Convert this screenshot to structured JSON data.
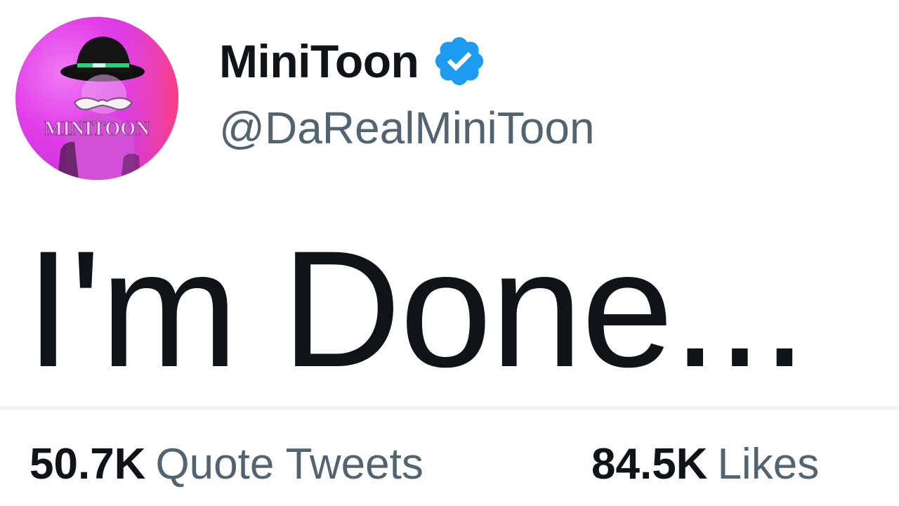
{
  "author": {
    "display_name": "MiniToon",
    "handle": "@DaRealMiniToon",
    "verified": true,
    "avatar_text": "MINITOON"
  },
  "tweet": {
    "text": "I'm Done..."
  },
  "stats": {
    "quote_tweets": {
      "count": "50.7K",
      "label": "Quote Tweets"
    },
    "likes": {
      "count": "84.5K",
      "label": "Likes"
    }
  },
  "colors": {
    "text_primary": "#0f1419",
    "text_secondary": "#536471",
    "verified_blue": "#1d9bf0",
    "divider": "#eff3f4",
    "avatar_pink": "#e040e6"
  },
  "icons": {
    "verified": "verified-badge-icon"
  }
}
